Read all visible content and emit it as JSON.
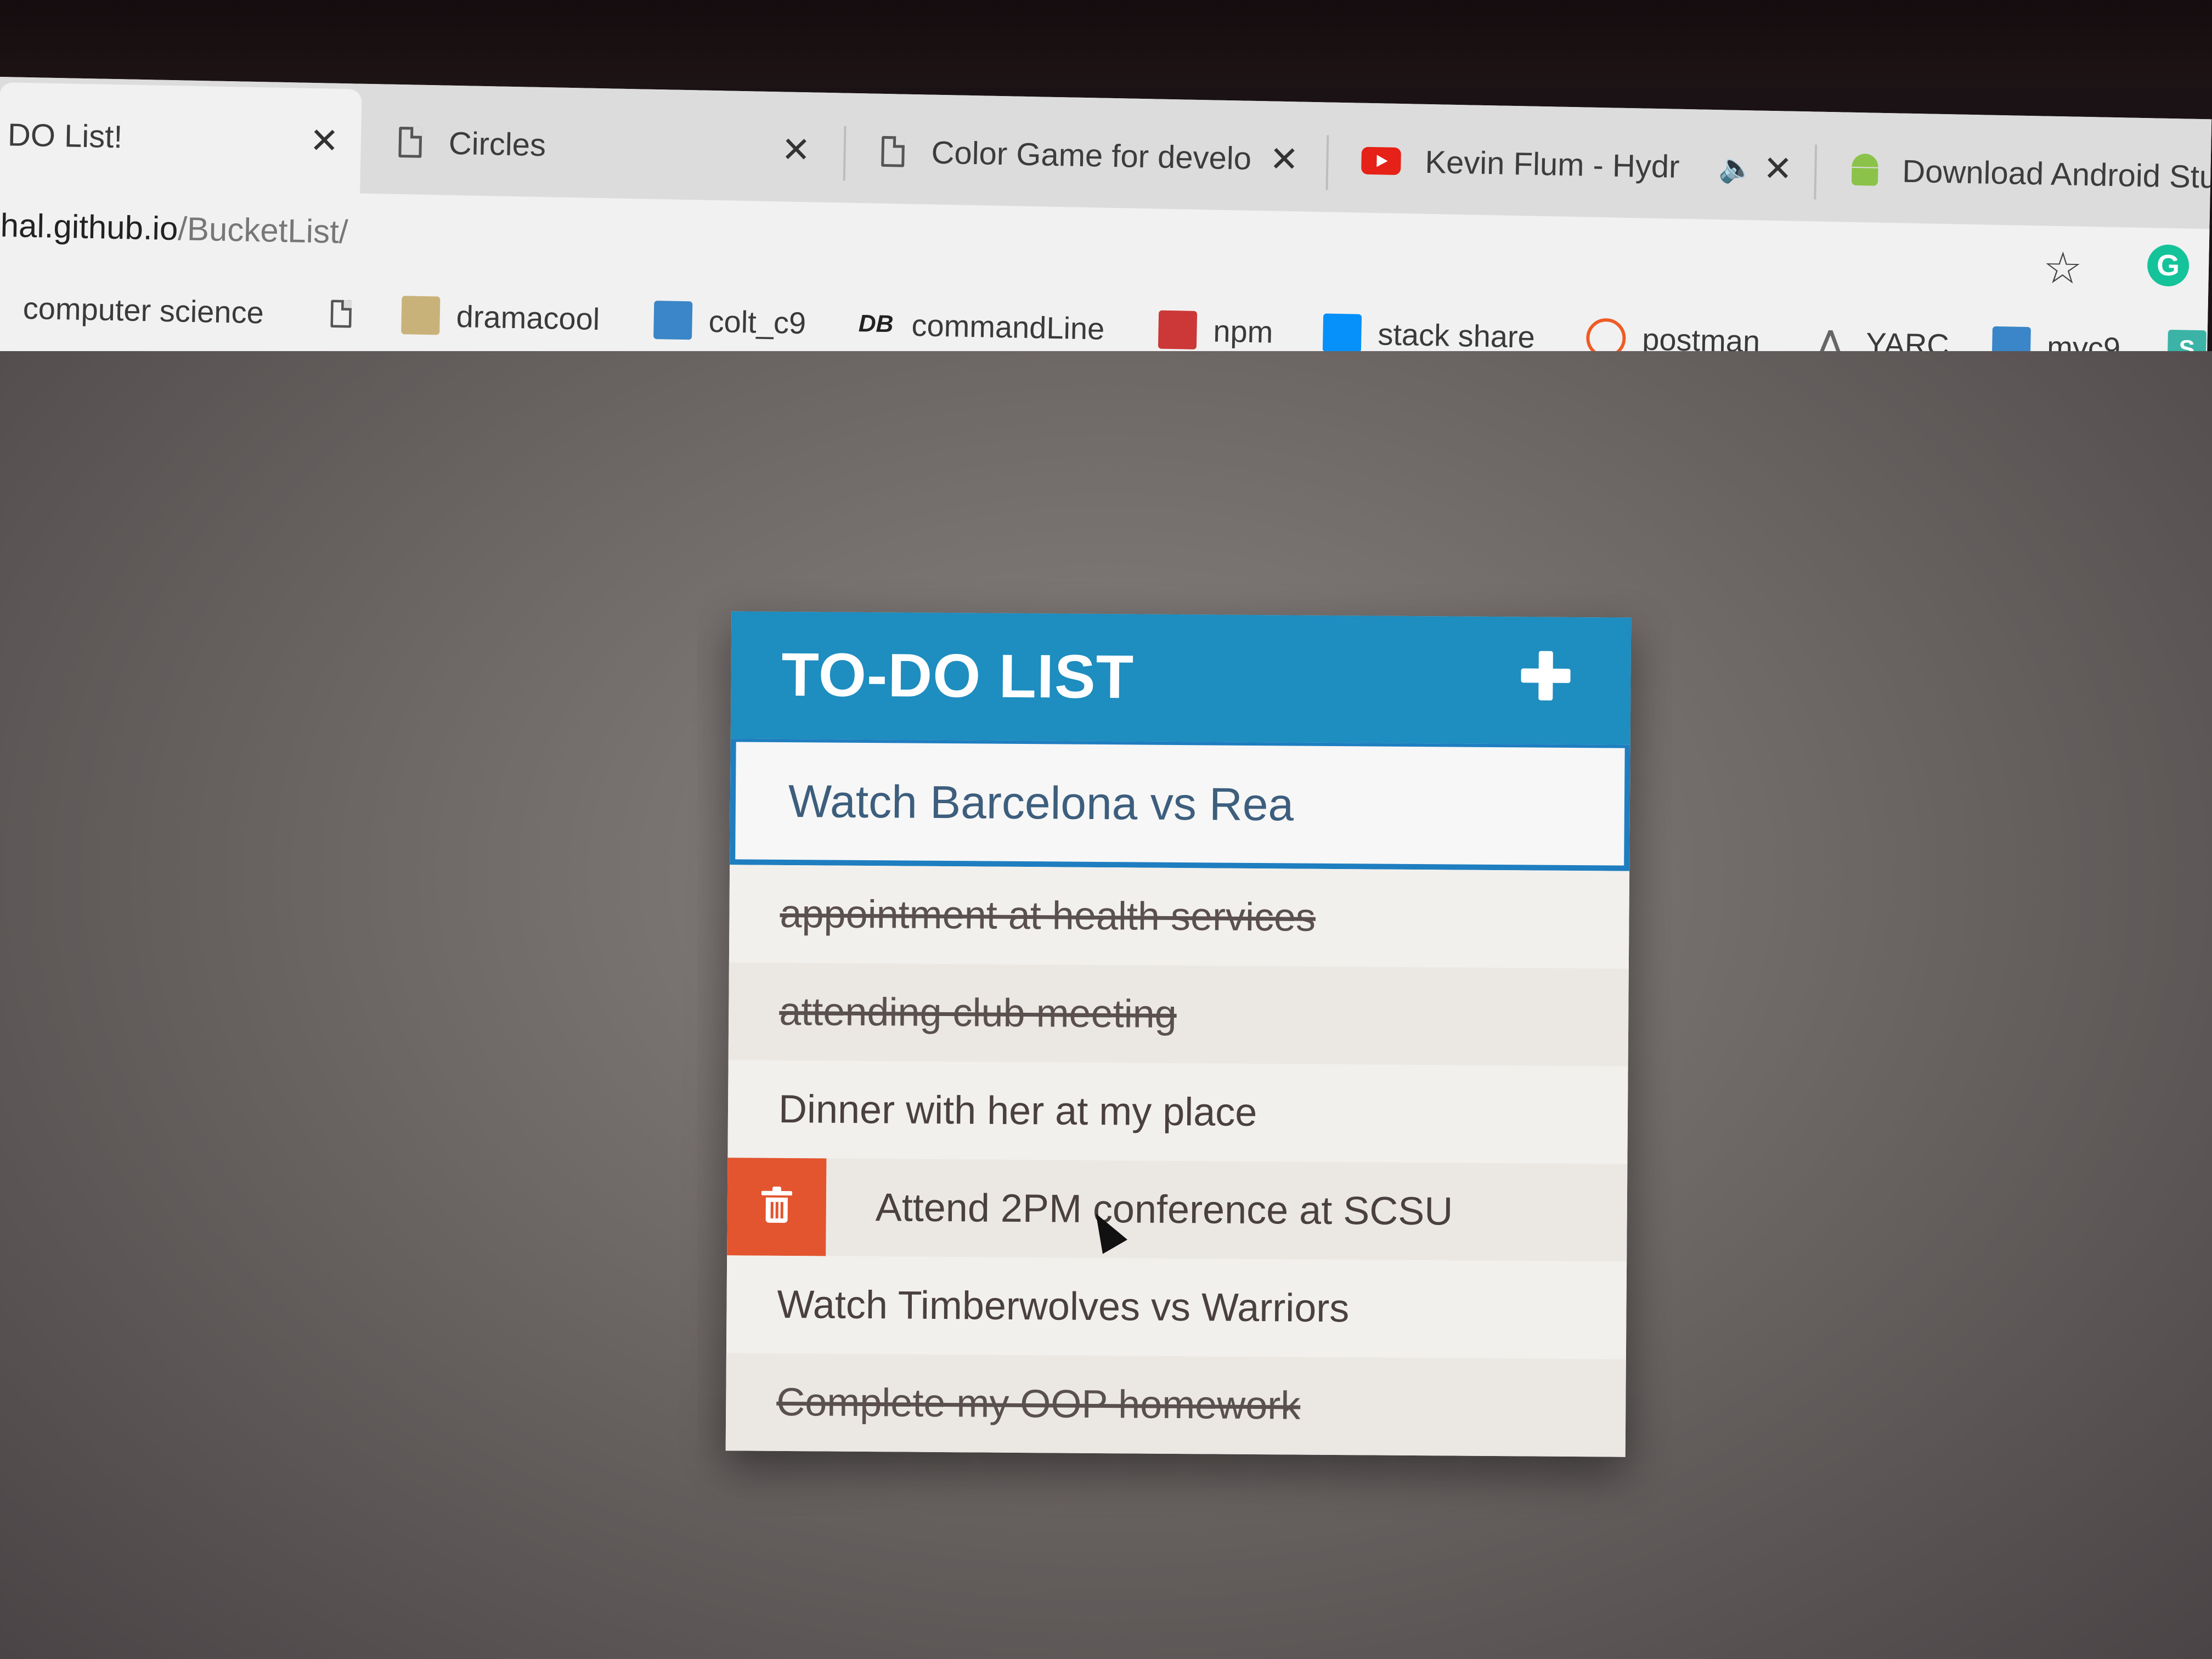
{
  "tabs": [
    {
      "title": "DO List!",
      "close": "✕"
    },
    {
      "title": "Circles",
      "close": "✕"
    },
    {
      "title": "Color Game for develo",
      "close": "✕"
    },
    {
      "title": "Kevin Flum - Hydr",
      "close": "✕",
      "audio": "🔈"
    },
    {
      "title": "Download Android Stu"
    }
  ],
  "address_bar": {
    "host": "hal.github.io",
    "path": "/BucketList/"
  },
  "toolbar": {
    "star": "☆",
    "extension": "G"
  },
  "bookmarks": [
    {
      "label": "computer science",
      "icon": "folder-icon"
    },
    {
      "label": "",
      "icon": "page-icon"
    },
    {
      "label": "dramacool",
      "icon": "dramacool-icon"
    },
    {
      "label": "colt_c9",
      "icon": "c9-icon"
    },
    {
      "label": "commandLine",
      "icon": "db-icon",
      "glyph": "DB"
    },
    {
      "label": "npm",
      "icon": "npm-icon"
    },
    {
      "label": "stack share",
      "icon": "share-icon"
    },
    {
      "label": "postman",
      "icon": "postman-icon"
    },
    {
      "label": "YARC",
      "icon": "yarc-icon"
    },
    {
      "label": "myc9",
      "icon": "c9-icon"
    },
    {
      "label": "",
      "icon": "s-icon",
      "glyph": "S"
    }
  ],
  "todo": {
    "title": "TO-DO LIST",
    "new_value": "Watch Barcelona vs Rea",
    "items": [
      {
        "text": "appointment at health services",
        "done": true
      },
      {
        "text": "attending club meeting",
        "done": true
      },
      {
        "text": "Dinner with her at my place",
        "done": false
      },
      {
        "text": "Attend 2PM conference at SCSU",
        "done": false
      },
      {
        "text": "Watch Timberwolves vs Warriors",
        "done": false
      },
      {
        "text": "Complete my OOP homework",
        "done": true
      }
    ]
  },
  "colors": {
    "header": "#1e8dbf",
    "delete": "#e2552f",
    "input_border": "#1e7ec0"
  }
}
